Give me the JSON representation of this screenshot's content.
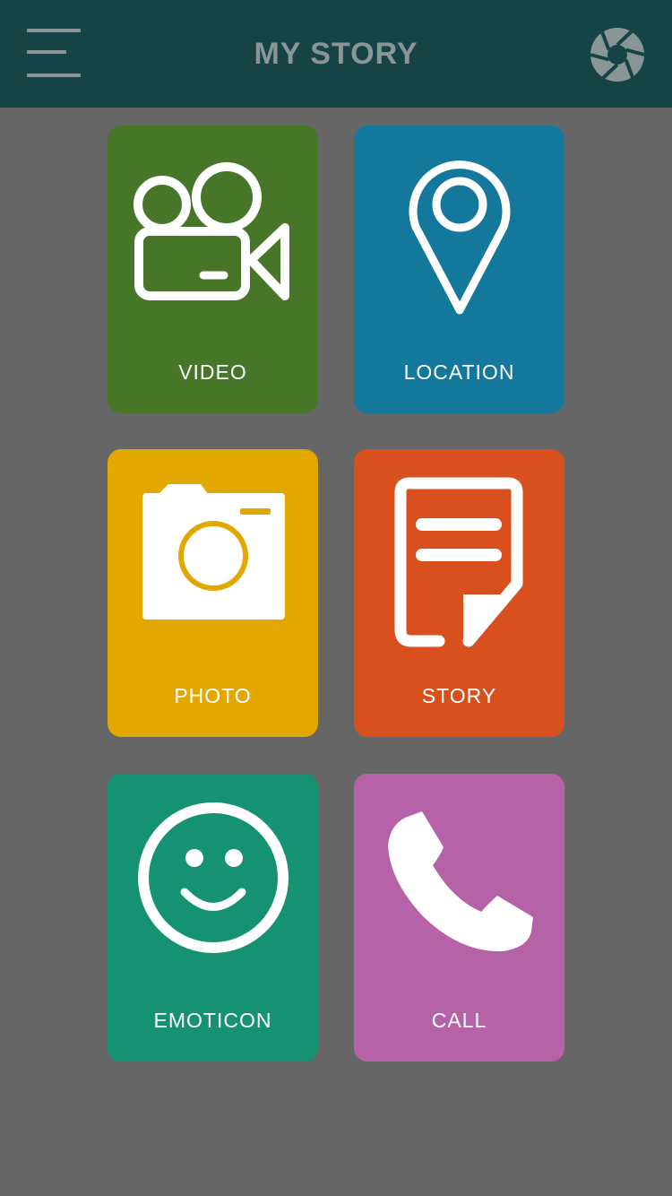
{
  "header": {
    "title": "MY STORY",
    "title_color": "#8a9596",
    "background": "#164446",
    "menu_icon": "hamburger-menu-icon",
    "right_icon": "camera-shutter-icon"
  },
  "background": "#666666",
  "tiles": [
    {
      "label": "VIDEO",
      "color": "#487629",
      "icon": "video-camera-icon"
    },
    {
      "label": "LOCATION",
      "color": "#13789c",
      "icon": "location-pin-icon"
    },
    {
      "label": "PHOTO",
      "color": "#e2a700",
      "icon": "photo-camera-icon"
    },
    {
      "label": "STORY",
      "color": "#d9501f",
      "icon": "document-icon"
    },
    {
      "label": "EMOTICON",
      "color": "#149272",
      "icon": "smiley-face-icon"
    },
    {
      "label": "CALL",
      "color": "#b562a8",
      "icon": "phone-handset-icon"
    }
  ]
}
